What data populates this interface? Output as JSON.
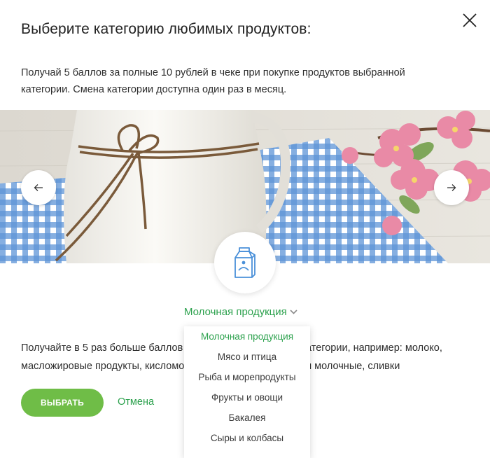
{
  "dialog": {
    "title": "Выберите категорию любимых продуктов:",
    "description": "Получай 5 баллов за полные 10 рублей в чеке при покупке продуктов выбранной категории. Смена категории доступна один раз в месяц."
  },
  "category": {
    "selected": "Молочная продукция",
    "icon": "milk-carton-icon",
    "body_text": "Получайте в 5 раз больше баллов за покупку продуктов из категории, например: молоко, масложировые продукты, кисломолочные продукты, десерты молочные, сливки"
  },
  "dropdown": {
    "options": [
      {
        "label": "Молочная продукция",
        "selected": true
      },
      {
        "label": "Мясо и птица",
        "selected": false
      },
      {
        "label": "Рыба и морепродукты",
        "selected": false
      },
      {
        "label": "Фрукты и овощи",
        "selected": false
      },
      {
        "label": "Бакалея",
        "selected": false
      },
      {
        "label": "Сыры и колбасы",
        "selected": false
      }
    ]
  },
  "actions": {
    "choose_label": "ВЫБРАТЬ",
    "cancel_label": "Отмена"
  },
  "colors": {
    "accent": "#2ca14d",
    "button": "#6fbd47",
    "icon": "#4a90d9"
  }
}
